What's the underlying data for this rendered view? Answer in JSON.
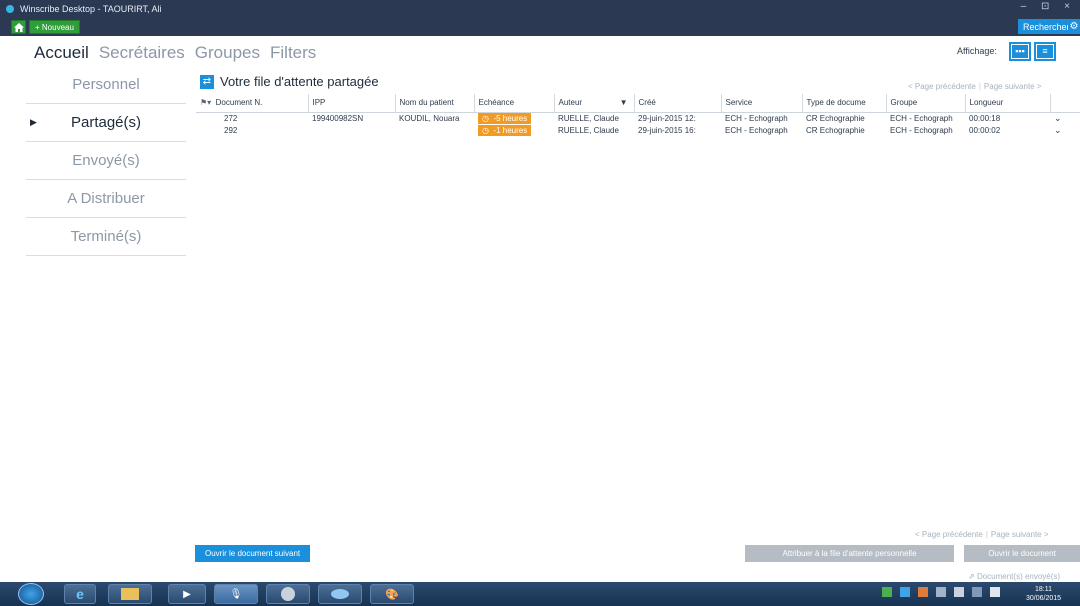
{
  "window": {
    "title": "Winscribe Desktop - TAOURIRT, Ali",
    "controls": "– ⊡ ×"
  },
  "toolbar": {
    "nouveau_label": "+ Nouveau",
    "recherche_label": "Rechercher",
    "settings_icon": "gear-icon"
  },
  "nav": {
    "tabs": [
      {
        "label": "Accueil"
      },
      {
        "label": "Secrétaires"
      },
      {
        "label": "Groupes"
      },
      {
        "label": "Filters"
      }
    ],
    "affichage_label": "Affichage:"
  },
  "sidebar": {
    "items": [
      {
        "label": "Personnel"
      },
      {
        "label": "Partagé(s)"
      },
      {
        "label": "Envoyé(s)"
      },
      {
        "label": "A Distribuer"
      },
      {
        "label": "Terminé(s)"
      }
    ]
  },
  "queue": {
    "title": "Votre file d'attente partagée",
    "prev_page": "< Page précédente",
    "next_page": "Page suivante >"
  },
  "table": {
    "columns": [
      "Document N.",
      "IPP",
      "Nom du patient",
      "Echéance",
      "Auteur",
      "Créé",
      "Service",
      "Type de docume",
      "Groupe",
      "Longueur"
    ],
    "rows": [
      {
        "doc": "272",
        "ipp": "199400982SN",
        "patient": "KOUDIL, Nouara",
        "echeance": "-5 heures",
        "auteur": "RUELLE, Claude",
        "cree": "29-juin-2015 12:",
        "service": "ECH - Echograph",
        "type": "CR Echographie",
        "groupe": "ECH - Echograph",
        "longueur": "00:00:18"
      },
      {
        "doc": "292",
        "ipp": "",
        "patient": "",
        "echeance": "-1 heures",
        "auteur": "RUELLE, Claude",
        "cree": "29-juin-2015 16:",
        "service": "ECH - Echograph",
        "type": "CR Echographie",
        "groupe": "ECH - Echograph",
        "longueur": "00:00:02"
      }
    ]
  },
  "footer": {
    "prev_page": "< Page précédente",
    "next_page": "Page suivante >",
    "open_next_label": "Ouvrir le document suivant",
    "assign_label": "Attribuer à la file d'attente personnelle",
    "open_label": "Ouvrir le document",
    "sent_label": "Document(s) envoyé(s)"
  },
  "taskbar": {
    "time": "18:11",
    "date": "30/06/2015"
  },
  "colors": {
    "accent": "#1a8fdc",
    "green": "#2f9e3a",
    "warning": "#f29b24",
    "titlebar": "#2b3a52"
  }
}
